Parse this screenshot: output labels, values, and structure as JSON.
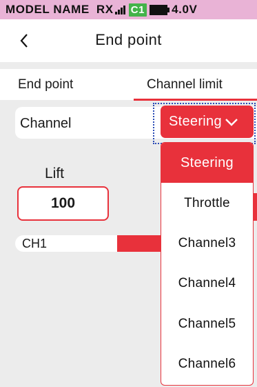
{
  "status": {
    "model_name": "MODEL NAME",
    "rx": "RX",
    "signal_icon": "signal-bars-icon",
    "chip": "C1",
    "battery_icon": "battery-icon",
    "voltage": "4.0V",
    "bg_color": "#e9b3d6",
    "chip_color": "#44b34a"
  },
  "header": {
    "back_icon": "chevron-left-icon",
    "title": "End point"
  },
  "tabs": [
    {
      "label": "End point",
      "active": false
    },
    {
      "label": "Channel limit",
      "active": true
    }
  ],
  "channel": {
    "label": "Channel",
    "selected": "Steering",
    "options": [
      "Steering",
      "Throttle",
      "Channel3",
      "Channel4",
      "Channel5",
      "Channel6"
    ]
  },
  "lift": {
    "label": "Lift",
    "value": "100"
  },
  "ch1": {
    "label": "CH1"
  },
  "colors": {
    "accent": "#e8313b"
  }
}
